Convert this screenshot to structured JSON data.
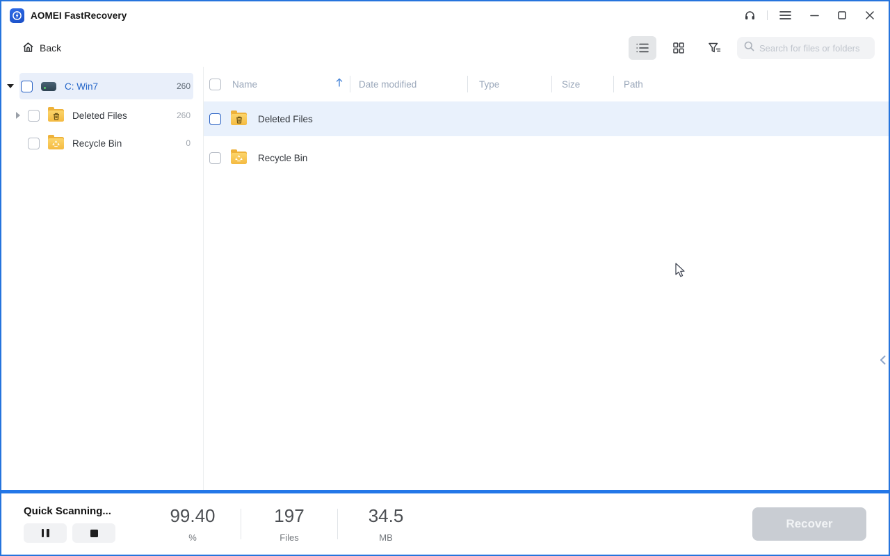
{
  "app": {
    "title": "AOMEI FastRecovery"
  },
  "toolbar": {
    "back_label": "Back",
    "search_placeholder": "Search for files or folders"
  },
  "sidebar": {
    "items": [
      {
        "label": "C: Win7",
        "count": "260",
        "icon": "drive-icon",
        "selected": true
      },
      {
        "label": "Deleted Files",
        "count": "260",
        "icon": "folder-trash-icon",
        "selected": false
      },
      {
        "label": "Recycle Bin",
        "count": "0",
        "icon": "folder-recycle-icon",
        "selected": false
      }
    ]
  },
  "table": {
    "columns": [
      "Name",
      "Date modified",
      "Type",
      "Size",
      "Path"
    ],
    "sort_column": "Name",
    "sort_direction": "ascending",
    "rows": [
      {
        "name": "Deleted Files",
        "icon": "folder-trash-icon",
        "highlighted": true
      },
      {
        "name": "Recycle Bin",
        "icon": "folder-recycle-icon",
        "highlighted": false
      }
    ]
  },
  "statusbar": {
    "status_label": "Quick Scanning...",
    "progress_percent": "99.40",
    "percent_unit": "%",
    "files_count": "197",
    "files_unit": "Files",
    "size_value": "34.5",
    "size_unit": "MB",
    "recover_label": "Recover"
  },
  "colors": {
    "accent_blue": "#2377e8",
    "window_border": "#2574dd",
    "selected_text": "#2465c8",
    "row_highlight": "#e9f1fc"
  }
}
